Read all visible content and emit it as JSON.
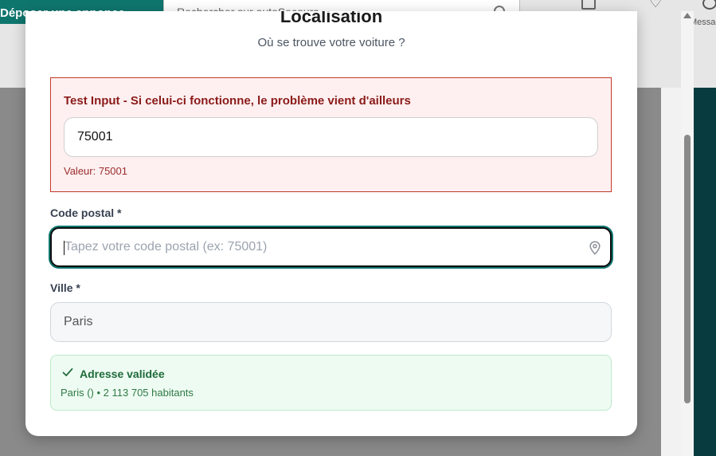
{
  "background": {
    "cta_label": "Déposer une annonce",
    "search_placeholder": "Rechercher sur autoSecours",
    "messages_label": "Messages"
  },
  "modal": {
    "title": "Localisation",
    "subtitle": "Où se trouve votre voiture ?"
  },
  "test_block": {
    "label": "Test Input - Si celui-ci fonctionne, le problème vient d'ailleurs",
    "input_value": "75001",
    "value_text": "Valeur: 75001"
  },
  "postal_code": {
    "label": "Code postal *",
    "placeholder": "Tapez votre code postal (ex: 75001)",
    "value": "",
    "icon": "map-pin-icon"
  },
  "city": {
    "label": "Ville *",
    "value": "Paris"
  },
  "validation": {
    "title": "Adresse validée",
    "detail": "Paris ()  • 2 113 705 habitants",
    "icon": "check-icon"
  },
  "colors": {
    "accent": "#0f766e",
    "error_border": "#c0392b",
    "error_text": "#8b1a1a",
    "success_text": "#1f6b3a",
    "success_bg": "#eefbf2"
  }
}
